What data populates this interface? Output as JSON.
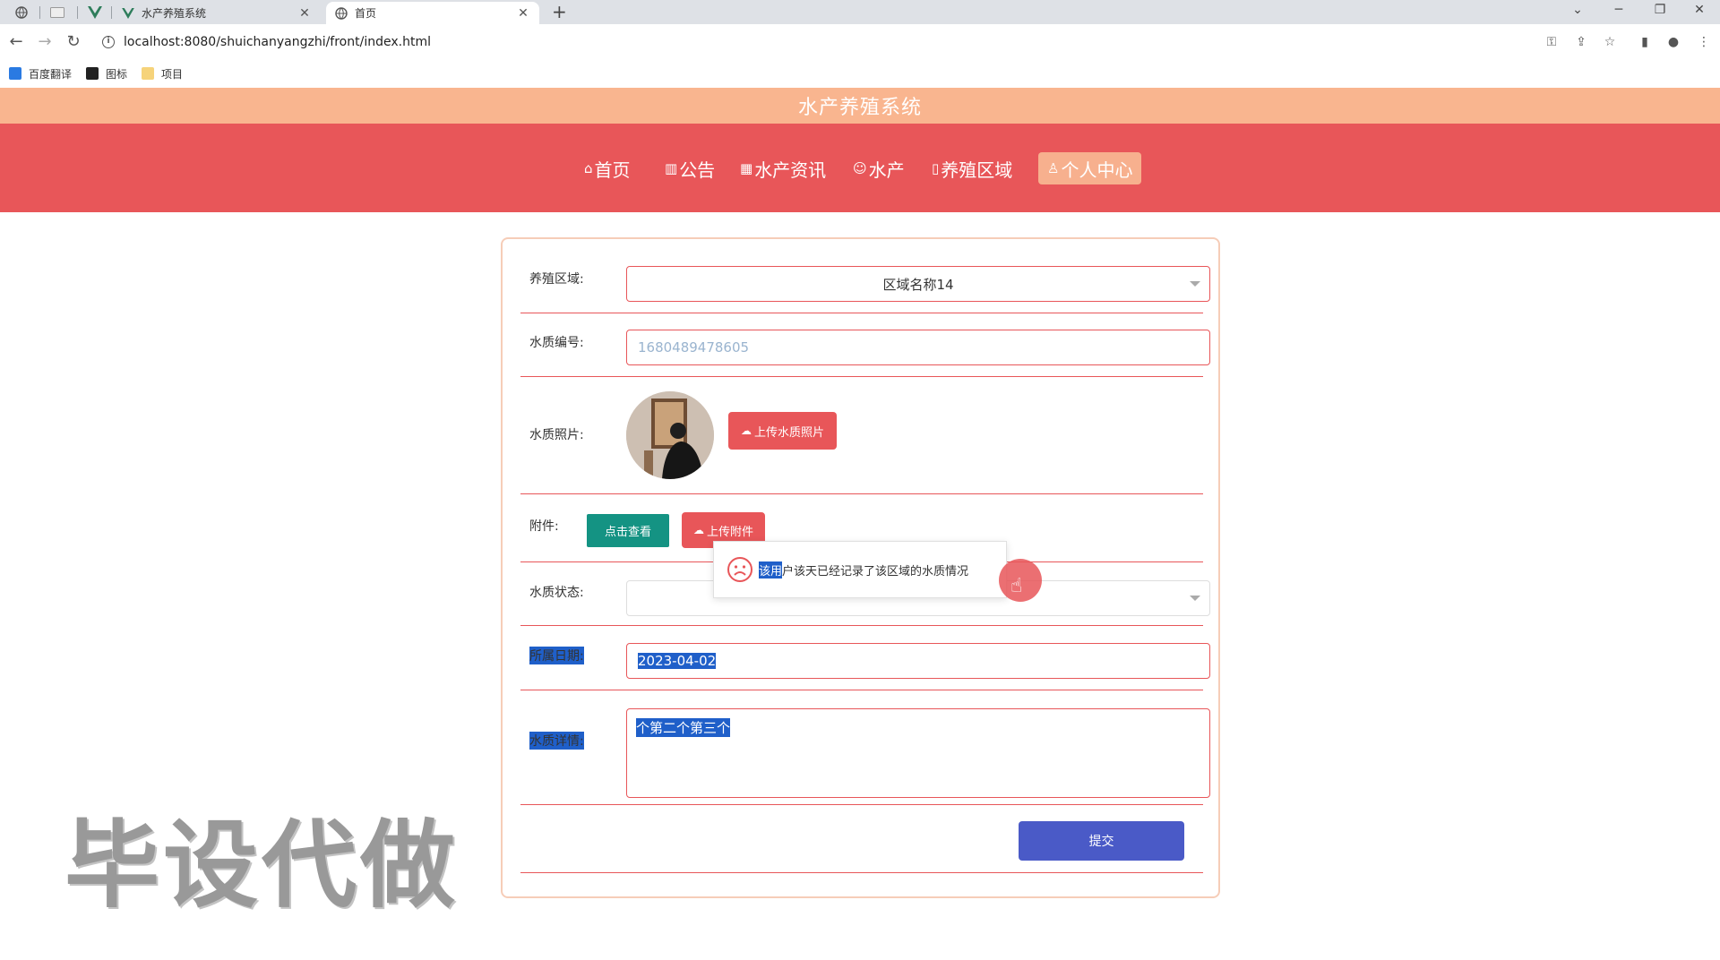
{
  "browser": {
    "tabs": [
      {
        "title": "水产养殖系统",
        "active": false
      },
      {
        "title": "首页",
        "active": true
      }
    ],
    "url": "localhost:8080/shuichanyangzhi/front/index.html",
    "bookmarks": [
      "百度翻译",
      "图标",
      "项目"
    ]
  },
  "site": {
    "title": "水产养殖系统",
    "nav": [
      {
        "icon": "⌂",
        "label": "首页"
      },
      {
        "icon": "▥",
        "label": "公告"
      },
      {
        "icon": "▦",
        "label": "水产资讯"
      },
      {
        "icon": "☺",
        "label": "水产"
      },
      {
        "icon": "▯",
        "label": "养殖区域"
      },
      {
        "icon": "♙",
        "label": "个人中心"
      }
    ]
  },
  "form": {
    "area_label": "养殖区域:",
    "area_value": "区域名称14",
    "code_label": "水质编号:",
    "code_value": "1680489478605",
    "photo_label": "水质照片:",
    "photo_upload": "上传水质照片",
    "attach_label": "附件:",
    "attach_view": "点击查看",
    "attach_upload": "上传附件",
    "status_label": "水质状态:",
    "date_label": "所属日期:",
    "date_value": "2023-04-02",
    "detail_label": "水质详情:",
    "detail_value": "个第二个第三个",
    "submit": "提交"
  },
  "toast": {
    "highlight": "该用",
    "message": "户该天已经记录了该区域的水质情况"
  },
  "watermark": "毕设代做",
  "colors": {
    "title_bar": "#f9b58f",
    "nav_bar": "#e85659",
    "accent": "#e85659",
    "teal": "#149383",
    "submit": "#4a5ac7"
  }
}
